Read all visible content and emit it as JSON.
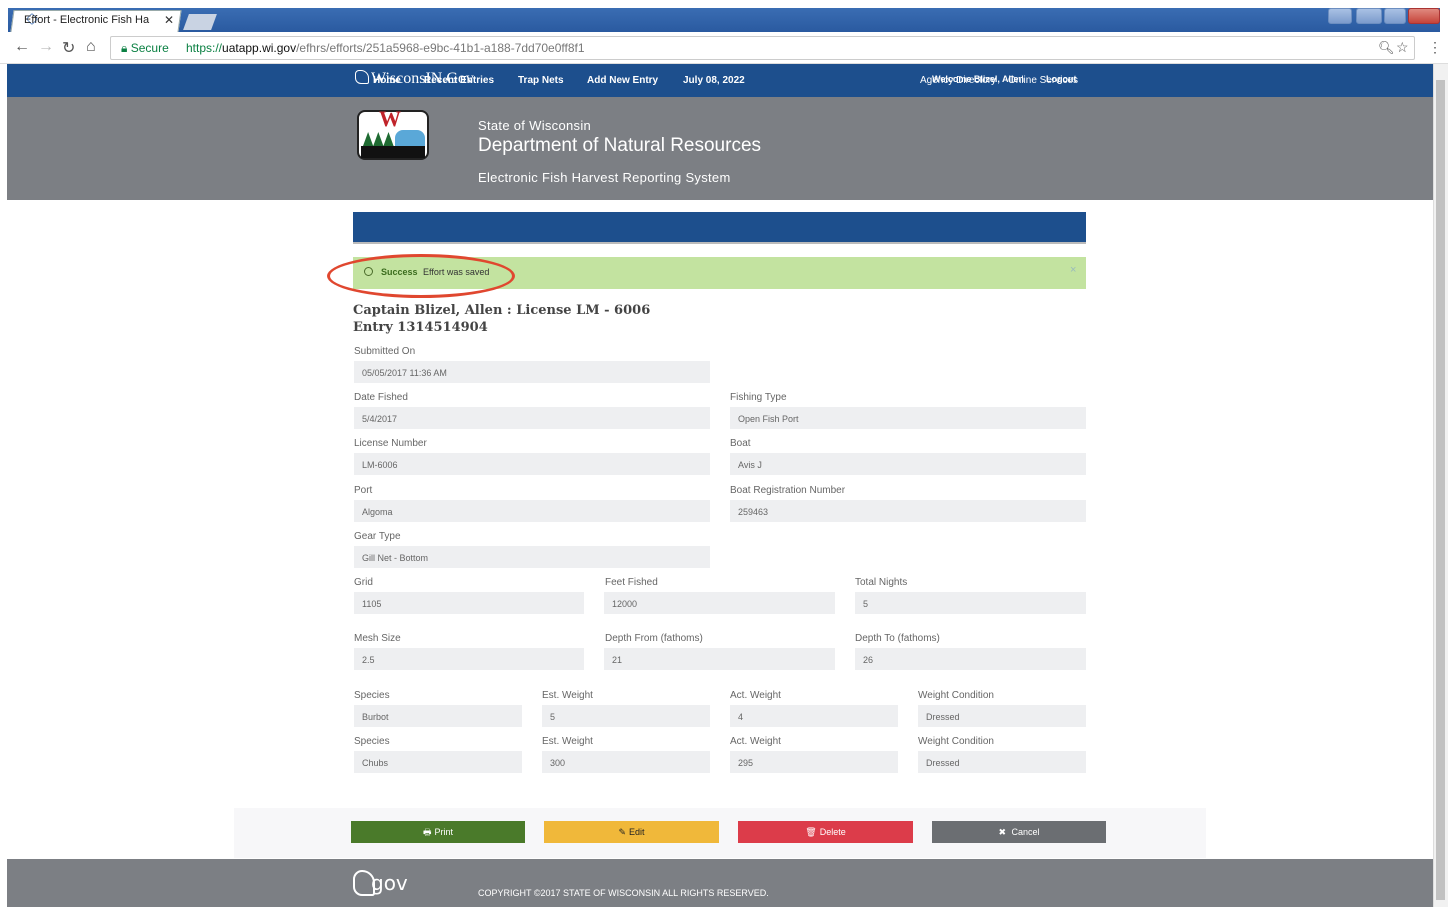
{
  "browser": {
    "tab_title": "Effort - Electronic Fish Ha",
    "secure_label": "Secure",
    "url_scheme": "https://",
    "url_host": "uatapp.wi.gov",
    "url_path": "/efhrs/efforts/251a5968-e9bc-41b1-a188-7dd70e0ff8f1"
  },
  "topbar": {
    "brand": "WisconsIN.Gov",
    "links": [
      "Agency Directory",
      "Online Services"
    ]
  },
  "header": {
    "state": "State of Wisconsin",
    "department": "Department of Natural Resources",
    "system": "Electronic Fish Harvest Reporting System"
  },
  "nav": {
    "items": [
      "Home",
      "Recent Entries",
      "Trap Nets",
      "Add New Entry"
    ],
    "date": "July 08, 2022",
    "welcome": "Welcome Blizel, Allen",
    "logout": "Logout"
  },
  "alert": {
    "title": "Success",
    "message": "Effort was saved",
    "close": "×"
  },
  "entry": {
    "heading": "Captain Blizel, Allen : License LM - 6006",
    "entry_line": "Entry 1314514904",
    "submitted_on_label": "Submitted On",
    "submitted_on": "05/05/2017 11:36 AM",
    "date_fished_label": "Date Fished",
    "date_fished": "5/4/2017",
    "fishing_type_label": "Fishing Type",
    "fishing_type": "Open Fish Port",
    "license_number_label": "License Number",
    "license_number": "LM-6006",
    "boat_label": "Boat",
    "boat": "Avis J",
    "port_label": "Port",
    "port": "Algoma",
    "boat_reg_label": "Boat Registration Number",
    "boat_reg": "259463",
    "gear_type_label": "Gear Type",
    "gear_type": "Gill Net - Bottom",
    "grid_label": "Grid",
    "grid": "1105",
    "feet_fished_label": "Feet Fished",
    "feet_fished": "12000",
    "total_nights_label": "Total Nights",
    "total_nights": "5",
    "mesh_size_label": "Mesh Size",
    "mesh_size": "2.5",
    "depth_from_label": "Depth From (fathoms)",
    "depth_from": "21",
    "depth_to_label": "Depth To (fathoms)",
    "depth_to": "26"
  },
  "catch_labels": {
    "species": "Species",
    "est_weight": "Est. Weight",
    "act_weight": "Act. Weight",
    "weight_condition": "Weight Condition"
  },
  "catch": [
    {
      "species": "Burbot",
      "est_weight": "5",
      "act_weight": "4",
      "condition": "Dressed"
    },
    {
      "species": "Chubs",
      "est_weight": "300",
      "act_weight": "295",
      "condition": "Dressed"
    }
  ],
  "buttons": {
    "print": "Print",
    "edit": "Edit",
    "delete": "Delete",
    "cancel": "Cancel"
  },
  "footer": {
    "logo": "gov",
    "copyright": "COPYRIGHT ©2017 STATE OF WISCONSIN ALL RIGHTS RESERVED."
  },
  "colors": {
    "nav_blue": "#1d4f8d",
    "header_gray": "#7c7f84",
    "success_bg": "#c3e3a0",
    "print": "#4a7a2a",
    "edit": "#f0b83a",
    "delete": "#dc3c4a",
    "cancel": "#6b6e72",
    "annotation_oval": "#e0472f"
  }
}
